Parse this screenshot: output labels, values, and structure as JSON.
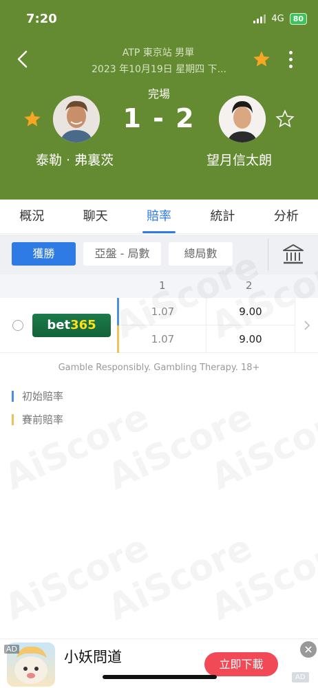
{
  "status_bar": {
    "time": "7:20",
    "network": "4G",
    "battery": "80"
  },
  "header": {
    "tournament": "ATP 東京站 男單",
    "datetime": "2023 年10月19日 星期四 下...",
    "status": "完場",
    "score": "1 - 2",
    "home_player": "泰勒 · 弗裏茨",
    "away_player": "望月信太朗"
  },
  "tabs": [
    {
      "label": "概況"
    },
    {
      "label": "聊天"
    },
    {
      "label": "賠率",
      "active": true
    },
    {
      "label": "統計"
    },
    {
      "label": "分析"
    }
  ],
  "filters": {
    "win": "獲勝",
    "handicap": "亞盤 - 局數",
    "total": "總局數"
  },
  "odds_table": {
    "col1": "1",
    "col2": "2",
    "bookmaker": {
      "name_prefix": "bet",
      "name_suffix": "365"
    },
    "opening": {
      "v1": "1.07",
      "v2": "9.00"
    },
    "pre_match": {
      "v1": "1.07",
      "v2": "9.00"
    }
  },
  "gamble_notice": "Gamble Responsibly. Gambling Therapy. 18+",
  "legend": {
    "opening": "初始賠率",
    "pre_match": "賽前賠率"
  },
  "watermark": "AiScore",
  "ad": {
    "tag": "AD",
    "title": "小妖問道",
    "cta": "立即下載",
    "corner": "AD"
  },
  "colors": {
    "header_bg": "#648a32",
    "accent": "#2f7be5",
    "star": "#f5a623",
    "opening_bar": "#4a90e2",
    "pre_match_bar": "#f0c05a",
    "ad_cta": "#f24957"
  }
}
